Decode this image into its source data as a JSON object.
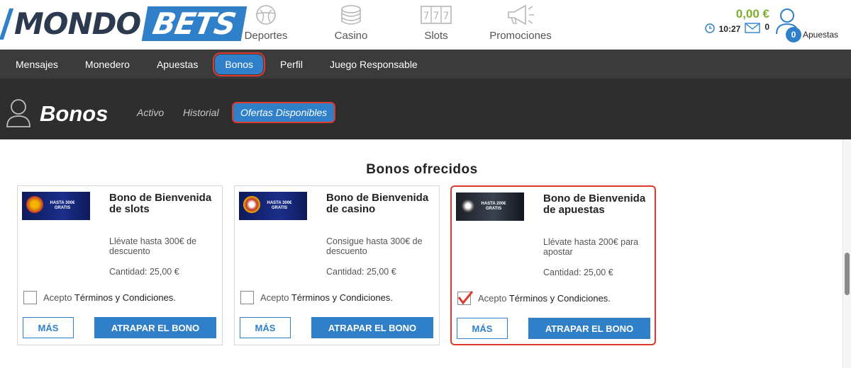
{
  "brand": {
    "part1": "MONDO",
    "part2": "BETS"
  },
  "top_nav": [
    {
      "label": "Deportes",
      "icon": "soccer-ball-icon"
    },
    {
      "label": "Casino",
      "icon": "chips-icon"
    },
    {
      "label": "Slots",
      "icon": "slot-machine-icon"
    },
    {
      "label": "Promociones",
      "icon": "megaphone-icon"
    }
  ],
  "account": {
    "balance": "0,00 €",
    "time": "10:27",
    "messages": "0",
    "bets_count": "0",
    "bets_label": "Apuestas"
  },
  "sub_nav": [
    "Mensajes",
    "Monedero",
    "Apuestas",
    "Bonos",
    "Perfil",
    "Juego Responsable"
  ],
  "page": {
    "title": "Bonos",
    "tabs": [
      "Activo",
      "Historial",
      "Ofertas Disponibles"
    ]
  },
  "section_title": "Bonos  ofrecidos",
  "cards": [
    {
      "title": "Bono de Bienvenida de slots",
      "desc": "Llévate hasta 300€ de descuento",
      "qty": "Cantidad: 25,00 €",
      "thumb_text": "HASTA 300€ GRATIS",
      "accept_prefix": "Acepto ",
      "accept_link": "Términos y Condiciones.",
      "checked": false,
      "btn_more": "MÁS",
      "btn_claim": "ATRAPAR EL BONO"
    },
    {
      "title": "Bono de Bienvenida de casino",
      "desc": "Consigue hasta 300€ de descuento",
      "qty": "Cantidad: 25,00 €",
      "thumb_text": "HASTA 300€ GRATIS",
      "accept_prefix": "Acepto ",
      "accept_link": "Términos y Condiciones.",
      "checked": false,
      "btn_more": "MÁS",
      "btn_claim": "ATRAPAR EL BONO"
    },
    {
      "title": "Bono de Bienvenida de apuestas",
      "desc": "Llévate hasta 200€ para apostar",
      "qty": "Cantidad: 25,00 €",
      "thumb_text": "HASTA 200€ GRATIS",
      "accept_prefix": "Acepto ",
      "accept_link": "Términos y Condiciones.",
      "checked": true,
      "btn_more": "MÁS",
      "btn_claim": "ATRAPAR EL BONO"
    }
  ]
}
